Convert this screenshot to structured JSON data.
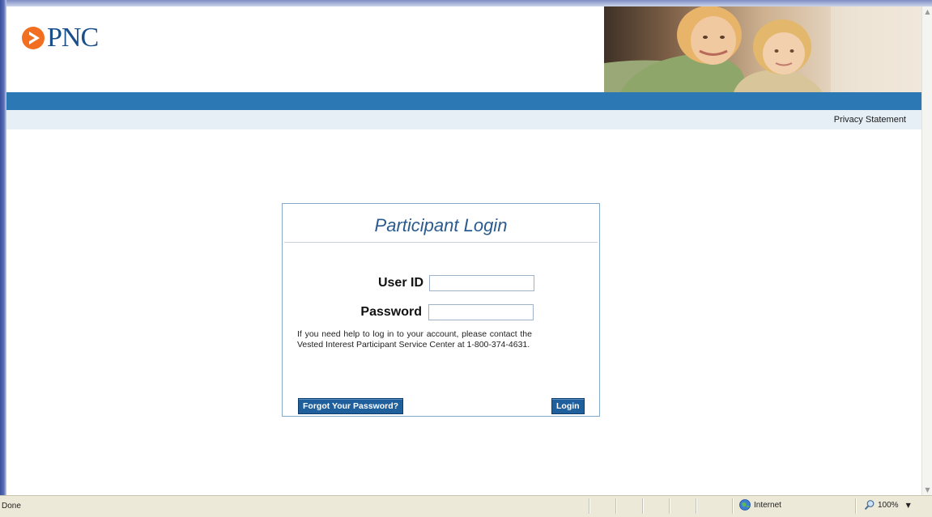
{
  "header": {
    "logo_text": "PNC",
    "privacy_link": "Privacy Statement"
  },
  "login": {
    "title": "Participant Login",
    "user_id_label": "User ID",
    "user_id_value": "",
    "password_label": "Password",
    "password_value": "",
    "help_text": "If you need help to log in to your account, please contact the Vested Interest Participant Service Center at 1-800-374-4631.",
    "forgot_button": "Forgot Your Password?",
    "login_button": "Login"
  },
  "statusbar": {
    "status": "Done",
    "zone": "Internet",
    "zoom": "100%"
  },
  "icons": {
    "logo": "pnc-logo-icon",
    "zone": "globe-icon",
    "zoom": "magnifier-icon",
    "zoom_menu": "caret-down-icon"
  },
  "colors": {
    "brand_blue": "#2b78b5",
    "title_blue": "#2a5a8e",
    "button_blue": "#1f5f9c",
    "logo_orange": "#f26f21",
    "sub_bar": "#e6eef6"
  }
}
